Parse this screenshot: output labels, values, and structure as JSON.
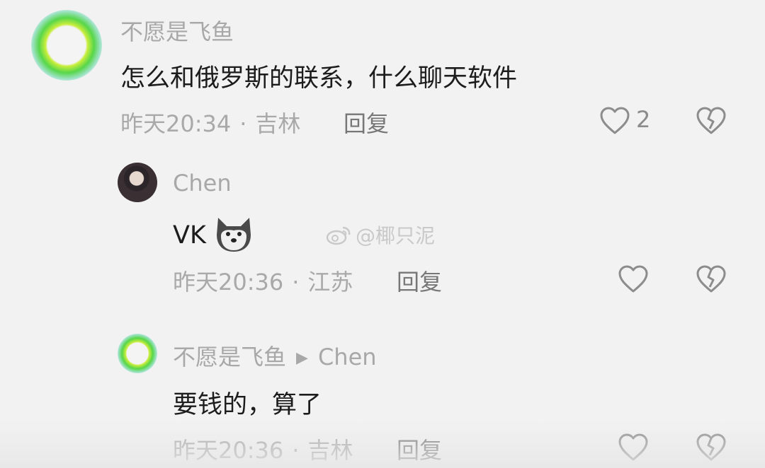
{
  "comments": [
    {
      "username": "不愿是飞鱼",
      "text": "怎么和俄罗斯的联系，什么聊天软件",
      "time": "昨天20:34",
      "location": "吉林",
      "reply_label": "回复",
      "like_count": "2",
      "avatar_icon": "green-ring-avatar"
    },
    {
      "username": "Chen",
      "text": "VK",
      "emoji_icon": "husky-dog-emoji",
      "time": "昨天20:36",
      "location": "江苏",
      "reply_label": "回复",
      "avatar_icon": "photo-avatar"
    },
    {
      "username": "不愿是飞鱼",
      "reply_to": "Chen",
      "text": "要钱的，算了",
      "time": "昨天20:36",
      "location": "吉林",
      "reply_label": "回复",
      "avatar_icon": "green-ring-avatar"
    }
  ],
  "watermark": {
    "text": "@椰只泥",
    "icon": "weibo-logo"
  },
  "colors": {
    "background": "#f2f2f2",
    "text": "#1c1c1c",
    "meta": "#a9a9a9",
    "avatar_ring": "#57d64a"
  }
}
